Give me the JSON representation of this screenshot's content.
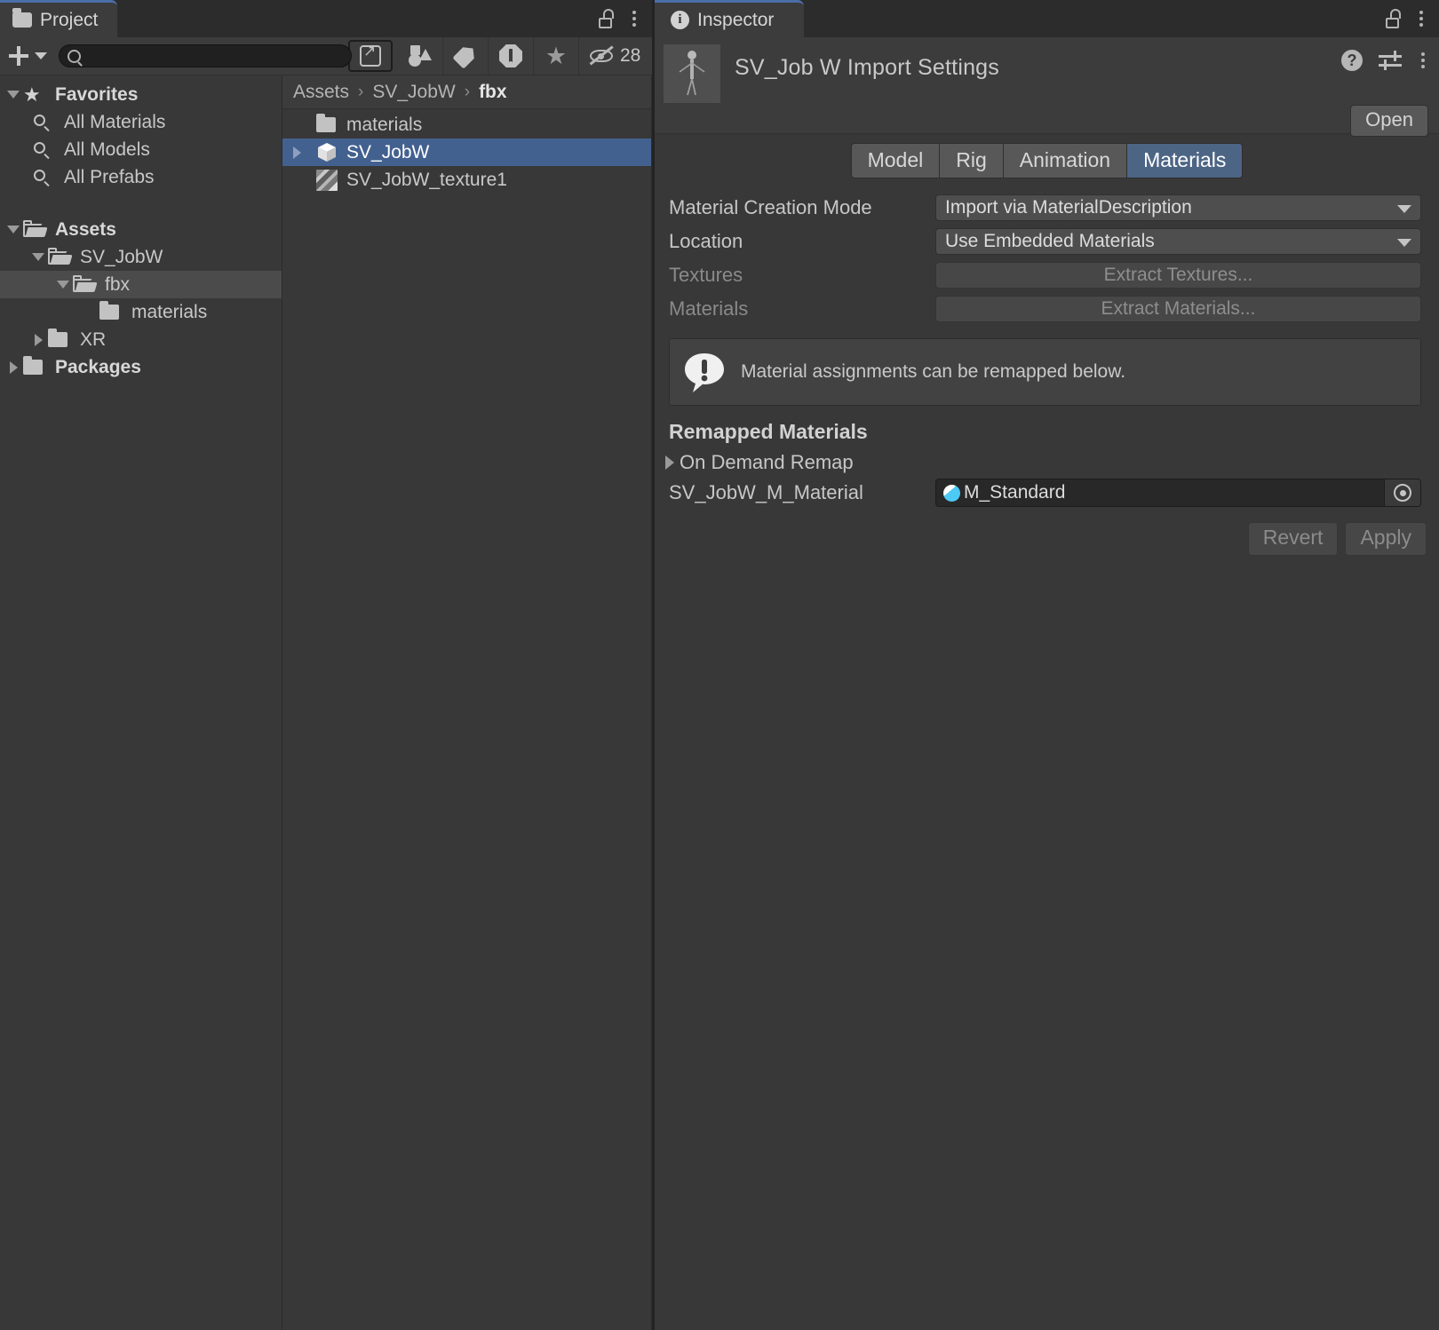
{
  "project_panel": {
    "tab_label": "Project",
    "tab_icon": "folder-icon",
    "lock_icon": "unlock-icon",
    "menu_icon": "kebab-menu-icon",
    "toolbar": {
      "add_label": "+",
      "add_dropdown_icon": "chevron-down-icon",
      "search_value": "",
      "search_placeholder": "",
      "search_icon": "search-icon",
      "buttons": [
        {
          "name": "open-in-new-window-button",
          "icon": "expand-window-icon"
        },
        {
          "name": "filter-by-type-button",
          "icon": "shapes-icon"
        },
        {
          "name": "filter-by-label-button",
          "icon": "tag-icon"
        },
        {
          "name": "filter-by-warning-button",
          "icon": "warning-icon"
        },
        {
          "name": "filter-by-favorite-button",
          "icon": "star-icon"
        }
      ],
      "hidden_icon": "eye-off-icon",
      "hidden_count": "28"
    },
    "tree": [
      {
        "label": "Favorites",
        "icon": "star-icon",
        "arrow": "down",
        "indent": 0,
        "bold": true,
        "selected": false
      },
      {
        "label": "All Materials",
        "icon": "search-icon",
        "arrow": "none",
        "indent": 1,
        "bold": false,
        "selected": false
      },
      {
        "label": "All Models",
        "icon": "search-icon",
        "arrow": "none",
        "indent": 1,
        "bold": false,
        "selected": false
      },
      {
        "label": "All Prefabs",
        "icon": "search-icon",
        "arrow": "none",
        "indent": 1,
        "bold": false,
        "selected": false
      },
      {
        "label": "",
        "icon": "none",
        "arrow": "none",
        "indent": 0,
        "bold": false,
        "selected": false,
        "spacer": true
      },
      {
        "label": "Assets",
        "icon": "folder-open-icon",
        "arrow": "down",
        "indent": 0,
        "bold": true,
        "selected": false
      },
      {
        "label": "SV_JobW",
        "icon": "folder-open-icon",
        "arrow": "down",
        "indent": 1,
        "bold": false,
        "selected": false
      },
      {
        "label": "fbx",
        "icon": "folder-open-icon",
        "arrow": "down",
        "indent": 2,
        "bold": false,
        "selected": true
      },
      {
        "label": "materials",
        "icon": "folder-icon",
        "arrow": "none",
        "indent": 3,
        "bold": false,
        "selected": false
      },
      {
        "label": "XR",
        "icon": "folder-icon",
        "arrow": "right",
        "indent": 1,
        "bold": false,
        "selected": false
      },
      {
        "label": "Packages",
        "icon": "folder-icon",
        "arrow": "right",
        "indent": 0,
        "bold": true,
        "selected": false
      }
    ],
    "breadcrumb": [
      {
        "label": "Assets",
        "current": false
      },
      {
        "label": "SV_JobW",
        "current": false
      },
      {
        "label": "fbx",
        "current": true
      }
    ],
    "breadcrumb_separator": "›",
    "assets": [
      {
        "label": "materials",
        "icon": "folder-icon",
        "expandable": false,
        "selected": false
      },
      {
        "label": "SV_JobW",
        "icon": "model-box-icon",
        "expandable": true,
        "selected": true
      },
      {
        "label": "SV_JobW_texture1",
        "icon": "texture-icon",
        "expandable": false,
        "selected": false
      }
    ]
  },
  "inspector_panel": {
    "tab_label": "Inspector",
    "tab_icon": "info-icon",
    "lock_icon": "unlock-icon",
    "menu_icon": "kebab-menu-icon",
    "title": "SV_Job W Import Settings",
    "thumbnail_icon": "humanoid-model-thumbnail",
    "help_icon": "help-icon",
    "preset_icon": "preset-sliders-icon",
    "more_icon": "kebab-menu-icon",
    "open_button": "Open",
    "tabs": [
      {
        "label": "Model",
        "active": false
      },
      {
        "label": "Rig",
        "active": false
      },
      {
        "label": "Animation",
        "active": false
      },
      {
        "label": "Materials",
        "active": true
      }
    ],
    "properties": [
      {
        "label": "Material Creation Mode",
        "value": "Import via MaterialDescription",
        "type": "popup",
        "disabled": false
      },
      {
        "label": "Location",
        "value": "Use Embedded Materials",
        "type": "popup",
        "disabled": false
      },
      {
        "label": "Textures",
        "value": "Extract Textures...",
        "type": "button",
        "disabled": true
      },
      {
        "label": "Materials",
        "value": "Extract Materials...",
        "type": "button",
        "disabled": true
      }
    ],
    "helpbox": {
      "icon": "info-bubble-icon",
      "text": "Material assignments can be remapped below."
    },
    "remapped_heading": "Remapped Materials",
    "foldout": {
      "label": "On Demand Remap",
      "expanded": false,
      "icon": "chevron-right-icon"
    },
    "material_slot": {
      "label": "SV_JobW_M_Material",
      "value": "M_Standard",
      "icon": "material-sphere-icon",
      "picker_icon": "object-picker-icon"
    },
    "footer": {
      "revert": "Revert",
      "apply": "Apply",
      "revert_disabled": true,
      "apply_disabled": true
    }
  },
  "colors": {
    "window_bg": "#383838",
    "panel_bg": "#3c3c3c",
    "tabbar_bg": "#2c2c2c",
    "selection_blue": "#43618f",
    "tab_active_blue": "#4d6585",
    "tab_accent": "#4b6ea8",
    "text": "#c7c7c7",
    "text_dim": "#8a8a8a"
  }
}
